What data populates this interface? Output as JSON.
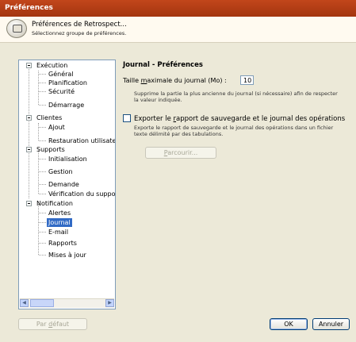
{
  "window": {
    "title": "Préférences"
  },
  "header": {
    "title": "Préférences de Retrospect...",
    "subtitle": "Sélectionnez groupe de préférences."
  },
  "tree": {
    "groups": [
      {
        "label": "Exécution",
        "children": [
          "Général",
          "Planification",
          "Sécurité",
          "Démarrage"
        ]
      },
      {
        "label": "Clientes",
        "children": [
          "Ajout",
          "Restauration utilisateur"
        ]
      },
      {
        "label": "Supports",
        "children": [
          "Initialisation",
          "Gestion",
          "Demande",
          "Vérification du support"
        ]
      },
      {
        "label": "Notification",
        "children": [
          "Alertes",
          "Journal",
          "E-mail",
          "Rapports",
          "Mises à jour"
        ]
      }
    ],
    "selected": "Journal"
  },
  "panel": {
    "title": "Journal - Préférences",
    "log_size": {
      "label_before": "Taille ",
      "label_mnemonic": "m",
      "label_after": "aximale du journal (Mo) :",
      "value": "10",
      "hint_line1": "Supprime la partie la plus ancienne du journal (si nécessaire) afin de respecter",
      "hint_line2": "la valeur indiquée."
    },
    "export": {
      "label_before": "Exporter le ",
      "label_mnemonic": "r",
      "label_after": "apport de sauvegarde et le journal des opérations",
      "checked": false,
      "hint_line1": "Exporte le rapport de sauvegarde et le journal des opérations dans un fichier",
      "hint_line2": "texte délimité par des tabulations."
    },
    "browse_button": {
      "mnemonic": "P",
      "rest": "arcourir..."
    }
  },
  "footer": {
    "default_button": {
      "before": "Par ",
      "mnemonic": "d",
      "after": "éfaut"
    },
    "ok_label": "OK",
    "cancel_label": "Annuler"
  }
}
